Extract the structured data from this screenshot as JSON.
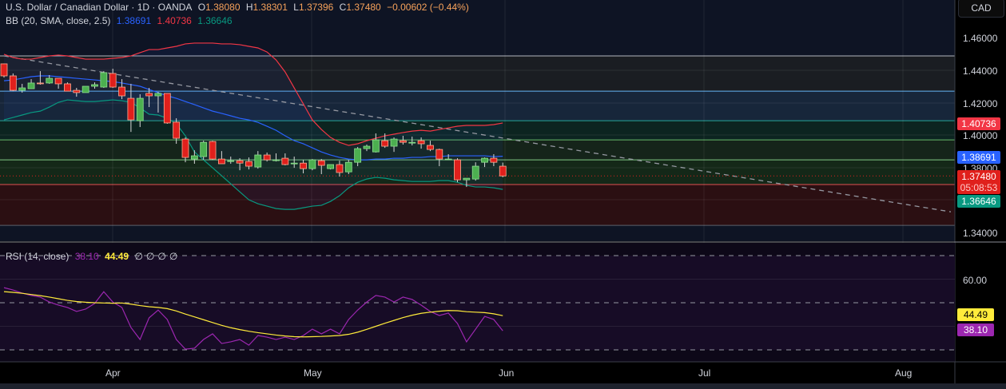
{
  "header": {
    "symbol_title": "U.S. Dollar / Canadian Dollar · 1D · OANDA",
    "open_label": "O",
    "open": "1.38080",
    "high_label": "H",
    "high": "1.38301",
    "low_label": "L",
    "low": "1.37396",
    "close_label": "C",
    "close": "1.37480",
    "change": "−0.00602 (−0.44%)"
  },
  "bb_legend": {
    "label": "BB (20, SMA, close, 2.5)",
    "basis": "1.38691",
    "upper": "1.40736",
    "lower": "1.36646"
  },
  "rsi_legend": {
    "label": "RSI (14, close)",
    "rsi": "38.10",
    "ma": "44.49",
    "extra": [
      "∅",
      "∅",
      "∅",
      "∅"
    ]
  },
  "currency_button": "CAD",
  "price_axis": [
    "1.46000",
    "1.44000",
    "1.42000",
    "1.40000",
    "1.38000",
    "1.34000"
  ],
  "price_badges": {
    "bb_upper": "1.40736",
    "bb_basis": "1.38691",
    "last_price": "1.37480",
    "countdown": "05:08:53",
    "bb_lower": "1.36646"
  },
  "rsi_axis": {
    "level": "60.00",
    "ma_badge": "44.49",
    "rsi_badge": "38.10"
  },
  "time_axis": [
    "Apr",
    "May",
    "Jun",
    "Jul",
    "Aug"
  ],
  "colors": {
    "up": "#4caf50",
    "down": "#e0201c",
    "bb_upper": "#f23645",
    "bb_basis": "#2962ff",
    "bb_lower": "#089981",
    "rsi": "#9c27b0",
    "rsi_ma": "#ffeb3b"
  },
  "chart_data": {
    "type": "candlestick",
    "title": "U.S. Dollar / Canadian Dollar · 1D · OANDA",
    "ylim": [
      1.33,
      1.475
    ],
    "ohlc": [
      [
        1.4438,
        1.444,
        1.4354,
        1.4364
      ],
      [
        1.4364,
        1.4379,
        1.427,
        1.4275
      ],
      [
        1.4275,
        1.4315,
        1.4261,
        1.429
      ],
      [
        1.4285,
        1.4344,
        1.4285,
        1.432
      ],
      [
        1.432,
        1.4393,
        1.431,
        1.4318
      ],
      [
        1.432,
        1.4369,
        1.4315,
        1.4349
      ],
      [
        1.4349,
        1.4349,
        1.4285,
        1.4315
      ],
      [
        1.4315,
        1.4324,
        1.427,
        1.427
      ],
      [
        1.4275,
        1.429,
        1.4236,
        1.4261
      ],
      [
        1.4261,
        1.43,
        1.4261,
        1.43
      ],
      [
        1.43,
        1.4324,
        1.4285,
        1.431
      ],
      [
        1.4295,
        1.4393,
        1.429,
        1.4384
      ],
      [
        1.4379,
        1.4408,
        1.429,
        1.4295
      ],
      [
        1.4295,
        1.4344,
        1.4221,
        1.4241
      ],
      [
        1.4226,
        1.4315,
        1.4019,
        1.4093
      ],
      [
        1.4088,
        1.4251,
        1.4049,
        1.4226
      ],
      [
        1.4256,
        1.429,
        1.4172,
        1.4241
      ],
      [
        1.4241,
        1.4265,
        1.4138,
        1.4256
      ],
      [
        1.4256,
        1.4256,
        1.4069,
        1.4074
      ],
      [
        1.4079,
        1.4103,
        1.3946,
        1.398
      ],
      [
        1.3975,
        1.3985,
        1.3832,
        1.3862
      ],
      [
        1.3852,
        1.3906,
        1.3823,
        1.3872
      ],
      [
        1.3867,
        1.3965,
        1.3847,
        1.3955
      ],
      [
        1.396,
        1.3965,
        1.3847,
        1.3852
      ],
      [
        1.3852,
        1.3901,
        1.3823,
        1.3823
      ],
      [
        1.3837,
        1.3867,
        1.3823,
        1.3842
      ],
      [
        1.3842,
        1.3857,
        1.3783,
        1.3827
      ],
      [
        1.3837,
        1.3862,
        1.3788,
        1.3808
      ],
      [
        1.3803,
        1.3901,
        1.3793,
        1.3877
      ],
      [
        1.3877,
        1.3892,
        1.3837,
        1.3847
      ],
      [
        1.3847,
        1.3887,
        1.3837,
        1.3847
      ],
      [
        1.3857,
        1.3887,
        1.3813,
        1.3818
      ],
      [
        1.3827,
        1.3867,
        1.3798,
        1.3827
      ],
      [
        1.3827,
        1.3847,
        1.3764,
        1.3793
      ],
      [
        1.3793,
        1.3852,
        1.3783,
        1.3847
      ],
      [
        1.3842,
        1.3852,
        1.3759,
        1.3813
      ],
      [
        1.3793,
        1.3818,
        1.3788,
        1.3818
      ],
      [
        1.3818,
        1.3842,
        1.3744,
        1.3769
      ],
      [
        1.3773,
        1.3847,
        1.3759,
        1.3832
      ],
      [
        1.3832,
        1.3926,
        1.3808,
        1.3916
      ],
      [
        1.3916,
        1.3941,
        1.3901,
        1.3931
      ],
      [
        1.3896,
        1.401,
        1.3892,
        1.397
      ],
      [
        1.3965,
        1.401,
        1.3921,
        1.3931
      ],
      [
        1.3931,
        1.3985,
        1.3896,
        1.3975
      ],
      [
        1.3965,
        1.3995,
        1.3941,
        1.3955
      ],
      [
        1.3955,
        1.399,
        1.3936,
        1.3955
      ],
      [
        1.3965,
        1.3985,
        1.3916,
        1.3946
      ],
      [
        1.3936,
        1.3965,
        1.3901,
        1.3911
      ],
      [
        1.3911,
        1.3916,
        1.3808,
        1.3852
      ],
      [
        1.3852,
        1.3882,
        1.3847,
        1.3852
      ],
      [
        1.3847,
        1.3857,
        1.3709,
        1.3724
      ],
      [
        1.3724,
        1.3734,
        1.368,
        1.3734
      ],
      [
        1.3729,
        1.3832,
        1.3719,
        1.3808
      ],
      [
        1.3832,
        1.3862,
        1.3803,
        1.3857
      ],
      [
        1.3857,
        1.3882,
        1.3808,
        1.3832
      ],
      [
        1.3808,
        1.383,
        1.374,
        1.3748
      ]
    ],
    "bb_upper": [
      1.4497,
      1.4477,
      1.4467,
      1.4467,
      1.4477,
      1.4487,
      1.4492,
      1.4487,
      1.4477,
      1.4467,
      1.4467,
      1.4467,
      1.4472,
      1.4477,
      1.4487,
      1.4507,
      1.4526,
      1.4526,
      1.4536,
      1.4546,
      1.4561,
      1.4566,
      1.4566,
      1.4566,
      1.4561,
      1.4561,
      1.4556,
      1.4546,
      1.4536,
      1.4511,
      1.4462,
      1.4388,
      1.429,
      1.4192,
      1.4093,
      1.4034,
      1.3985,
      1.3955,
      1.3936,
      1.3946,
      1.3965,
      1.398,
      1.3995,
      1.4005,
      1.4015,
      1.4024,
      1.4029,
      1.4024,
      1.4034,
      1.4044,
      1.4054,
      1.4059,
      1.4059,
      1.4059,
      1.4064,
      1.4074
    ],
    "bb_basis": [
      1.4334,
      1.4339,
      1.4349,
      1.4359,
      1.4364,
      1.4364,
      1.4359,
      1.4354,
      1.4349,
      1.4344,
      1.4339,
      1.4334,
      1.4329,
      1.432,
      1.431,
      1.43,
      1.428,
      1.4261,
      1.4241,
      1.4226,
      1.4206,
      1.4187,
      1.4167,
      1.4147,
      1.4133,
      1.4118,
      1.4103,
      1.4093,
      1.4078,
      1.4054,
      1.4029,
      1.3995,
      1.3965,
      1.3946,
      1.3921,
      1.3896,
      1.3877,
      1.3862,
      1.3852,
      1.3847,
      1.3847,
      1.3852,
      1.3852,
      1.3857,
      1.3857,
      1.3862,
      1.3862,
      1.3867,
      1.3867,
      1.3872,
      1.3872,
      1.3872,
      1.3872,
      1.3872,
      1.3867,
      1.3869
    ],
    "bb_lower": [
      1.4093,
      1.4108,
      1.4123,
      1.4138,
      1.4147,
      1.4172,
      1.4201,
      1.4216,
      1.4211,
      1.4206,
      1.4206,
      1.4211,
      1.4216,
      1.4211,
      1.4201,
      1.4167,
      1.4128,
      1.4123,
      1.4103,
      1.4069,
      1.3995,
      1.3896,
      1.3847,
      1.3798,
      1.3749,
      1.37,
      1.365,
      1.3601,
      1.3577,
      1.3562,
      1.3547,
      1.3542,
      1.3542,
      1.3552,
      1.3562,
      1.3567,
      1.3591,
      1.3626,
      1.3675,
      1.3709,
      1.3729,
      1.3739,
      1.3734,
      1.3724,
      1.3719,
      1.3714,
      1.3714,
      1.3714,
      1.3719,
      1.3719,
      1.3709,
      1.369,
      1.368,
      1.368,
      1.3675,
      1.3665
    ],
    "trendline": {
      "start": [
        0,
        1.4487
      ],
      "end": [
        104.4,
        1.3527
      ]
    },
    "levels": [
      1.4487,
      1.427,
      1.4088,
      1.397,
      1.3847,
      1.3695,
      1.3444
    ],
    "rsi": [
      56.4,
      55.4,
      54.1,
      53.1,
      52.4,
      50.3,
      49.0,
      48.0,
      46.3,
      47.3,
      49.7,
      54.7,
      50.3,
      48.0,
      39.5,
      34.4,
      43.6,
      46.9,
      42.9,
      34.4,
      30.3,
      30.7,
      34.4,
      36.8,
      32.7,
      33.4,
      34.4,
      32.0,
      36.1,
      35.4,
      34.4,
      35.4,
      34.4,
      36.1,
      38.8,
      36.8,
      38.8,
      36.8,
      42.9,
      46.9,
      50.3,
      53.1,
      52.4,
      50.3,
      52.4,
      51.4,
      49.0,
      46.3,
      44.6,
      45.6,
      41.2,
      33.4,
      38.8,
      44.2,
      42.9,
      38.1
    ],
    "rsi_ma": [
      54.7,
      54.4,
      54.0,
      53.5,
      53.0,
      52.4,
      51.7,
      51.0,
      50.5,
      50.2,
      50.0,
      49.9,
      49.8,
      49.9,
      49.4,
      48.8,
      48.3,
      48.0,
      47.5,
      46.5,
      45.2,
      44.0,
      42.8,
      41.6,
      40.4,
      39.4,
      38.6,
      37.9,
      37.3,
      36.8,
      36.3,
      35.9,
      35.6,
      35.5,
      35.6,
      35.7,
      35.9,
      36.1,
      36.6,
      37.5,
      38.7,
      40.0,
      41.3,
      42.5,
      43.7,
      44.7,
      45.5,
      46.0,
      46.4,
      46.7,
      46.6,
      46.2,
      46.0,
      45.8,
      45.3,
      44.5
    ],
    "rsi_levels": [
      70,
      50,
      30
    ],
    "rsi_ylim": [
      20,
      80
    ]
  }
}
